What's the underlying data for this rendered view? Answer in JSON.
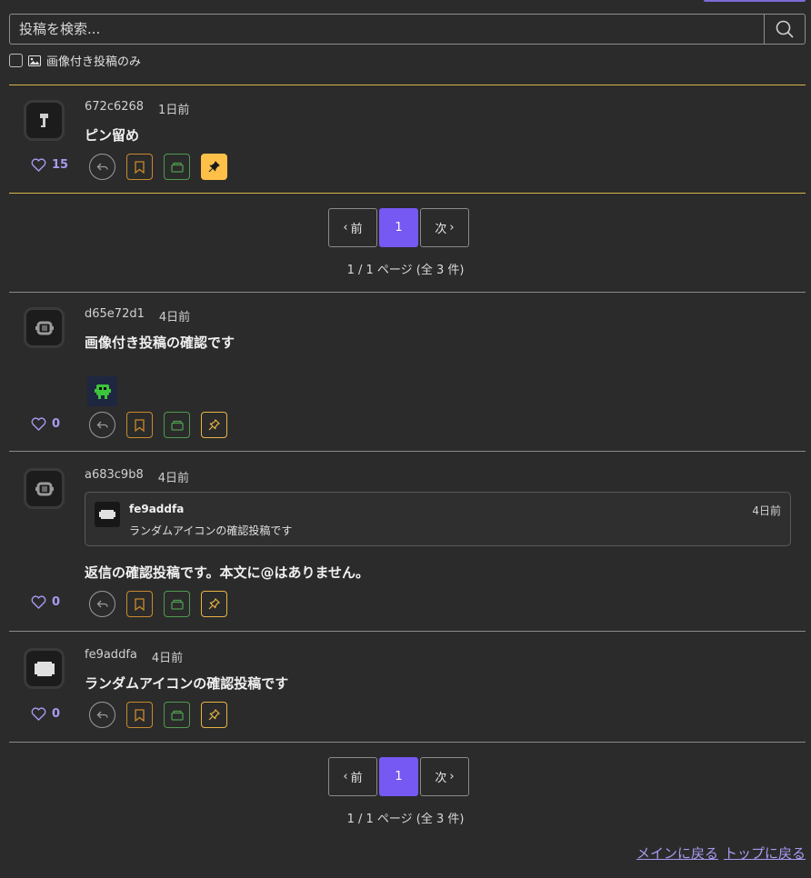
{
  "search": {
    "placeholder": "投稿を検索..."
  },
  "filter": {
    "image_only_label": "画像付き投稿のみ"
  },
  "pagination_top": {
    "prev": "前",
    "current": "1",
    "next": "次",
    "info": "1 / 1 ページ (全 3 件)"
  },
  "pagination_bottom": {
    "prev": "前",
    "current": "1",
    "next": "次",
    "info": "1 / 1 ページ (全 3 件)"
  },
  "pinned_post": {
    "author": "672c6268",
    "time": "1日前",
    "text": "ピン留め",
    "likes": "15"
  },
  "posts": [
    {
      "author": "d65e72d1",
      "time": "4日前",
      "text": "画像付き投稿の確認です",
      "likes": "0"
    },
    {
      "author": "a683c9b8",
      "time": "4日前",
      "text": "返信の確認投稿です。本文に@はありません。",
      "likes": "0",
      "quote": {
        "author": "fe9addfa",
        "time": "4日前",
        "text": "ランダムアイコンの確認投稿です"
      }
    },
    {
      "author": "fe9addfa",
      "time": "4日前",
      "text": "ランダムアイコンの確認投稿です",
      "likes": "0"
    }
  ],
  "footer": {
    "back_main": "メインに戻る",
    "back_top": "トップに戻る"
  },
  "colors": {
    "accent": "#7658f2",
    "pin": "#ffc04a",
    "like": "#a89af0"
  }
}
